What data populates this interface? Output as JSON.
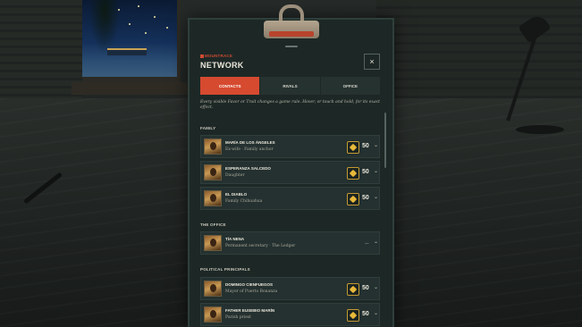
{
  "header": {
    "brand": "MOUNTRACE",
    "title": "NETWORK",
    "close_glyph": "×"
  },
  "tabs": [
    {
      "label": "CONTACTS",
      "active": true
    },
    {
      "label": "RIVALS",
      "active": false
    },
    {
      "label": "OFFICE",
      "active": false
    }
  ],
  "hint": "Every visible Favor or Trait changes a game rule. Hover, or touch and hold, for its exact effect.",
  "sections": {
    "family": {
      "label": "FAMILY",
      "contacts": [
        {
          "name": "MARÍA DE LOS ÁNGELES",
          "role": "Ex-wife · Family anchor",
          "favor_value": "50",
          "favor_icon": "favor-token-icon"
        },
        {
          "name": "ESPERANZA SALCEDO",
          "role": "Daughter",
          "favor_value": "50",
          "favor_icon": "favor-token-icon"
        },
        {
          "name": "EL DIABLO",
          "role": "Family Chihuahua",
          "favor_value": "50",
          "favor_icon": "favor-token-icon"
        }
      ]
    },
    "office": {
      "label": "THE OFFICE",
      "contacts": [
        {
          "name": "TÍA NENA",
          "role": "Permanent secretary · The Ledger",
          "mini_value": "—"
        }
      ]
    },
    "political": {
      "label": "POLITICAL PRINCIPALS",
      "contacts": [
        {
          "name": "DOMINGO CIENFUEGOS",
          "role": "Mayor of Puerto Bonanza",
          "favor_value": "50",
          "favor_icon": "favor-token-icon"
        },
        {
          "name": "FATHER EUSEBIO MARÍN",
          "role": "Parish priest",
          "favor_value": "50",
          "favor_icon": "favor-token-icon"
        }
      ]
    }
  },
  "colors": {
    "accent": "#d64a2f",
    "panel": "#1d2826",
    "card": "#243130",
    "favor_gold": "#e8b83a"
  }
}
